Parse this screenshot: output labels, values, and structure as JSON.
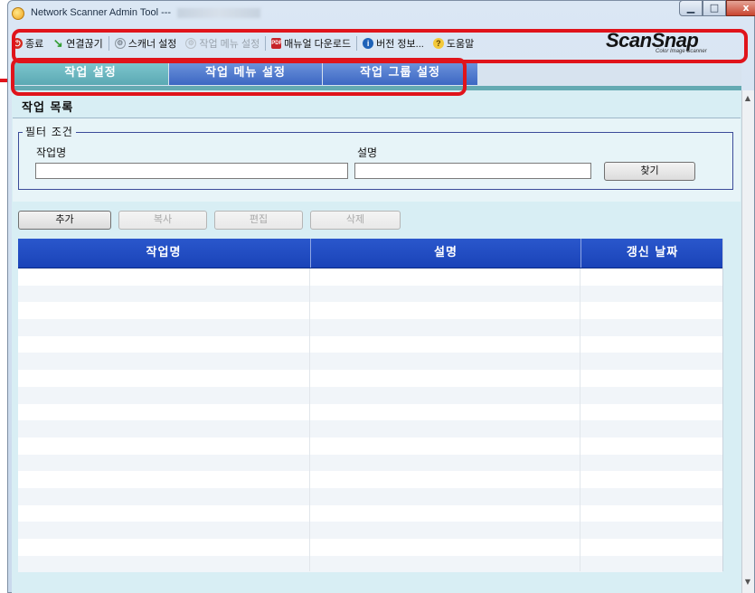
{
  "window": {
    "title": "Network Scanner Admin Tool ---",
    "minimize_glyph": "▁",
    "maximize_glyph": "□",
    "close_glyph": "x"
  },
  "toolbar": {
    "items": [
      {
        "label": "종료",
        "icon": "exit-icon",
        "enabled": true
      },
      {
        "label": "연결끊기",
        "icon": "disconnect-icon",
        "enabled": true
      },
      {
        "label": "스캐너 설정",
        "icon": "gear-icon",
        "enabled": true
      },
      {
        "label": "작업 메뉴 설정",
        "icon": "gear-icon",
        "enabled": false
      },
      {
        "label": "매뉴얼 다운로드",
        "icon": "pdf-icon",
        "enabled": true
      },
      {
        "label": "버전 정보...",
        "icon": "info-icon",
        "enabled": true
      },
      {
        "label": "도움말",
        "icon": "help-icon",
        "enabled": true
      }
    ],
    "logo": {
      "main": "ScanSnap",
      "sub": "Color Image Scanner"
    }
  },
  "tabs": [
    {
      "label": "작업 설정",
      "active": true
    },
    {
      "label": "작업 메뉴 설정",
      "active": false
    },
    {
      "label": "작업 그룹 설정",
      "active": false
    }
  ],
  "main": {
    "section_title": "작업 목록",
    "filter": {
      "legend": "필터 조건",
      "name_label": "작업명",
      "name_value": "",
      "desc_label": "설명",
      "desc_value": "",
      "find_button": "찾기"
    },
    "actions": {
      "add": "추가",
      "copy": "복사",
      "edit": "편집",
      "delete": "삭제"
    },
    "table": {
      "columns": [
        "작업명",
        "설명",
        "갱신 날짜"
      ],
      "rows": []
    }
  },
  "colors": {
    "callout": "#e0141b",
    "tab_active": "#5ba9b3",
    "tab_inactive": "#3c67c3",
    "table_header": "#1a43b8"
  }
}
